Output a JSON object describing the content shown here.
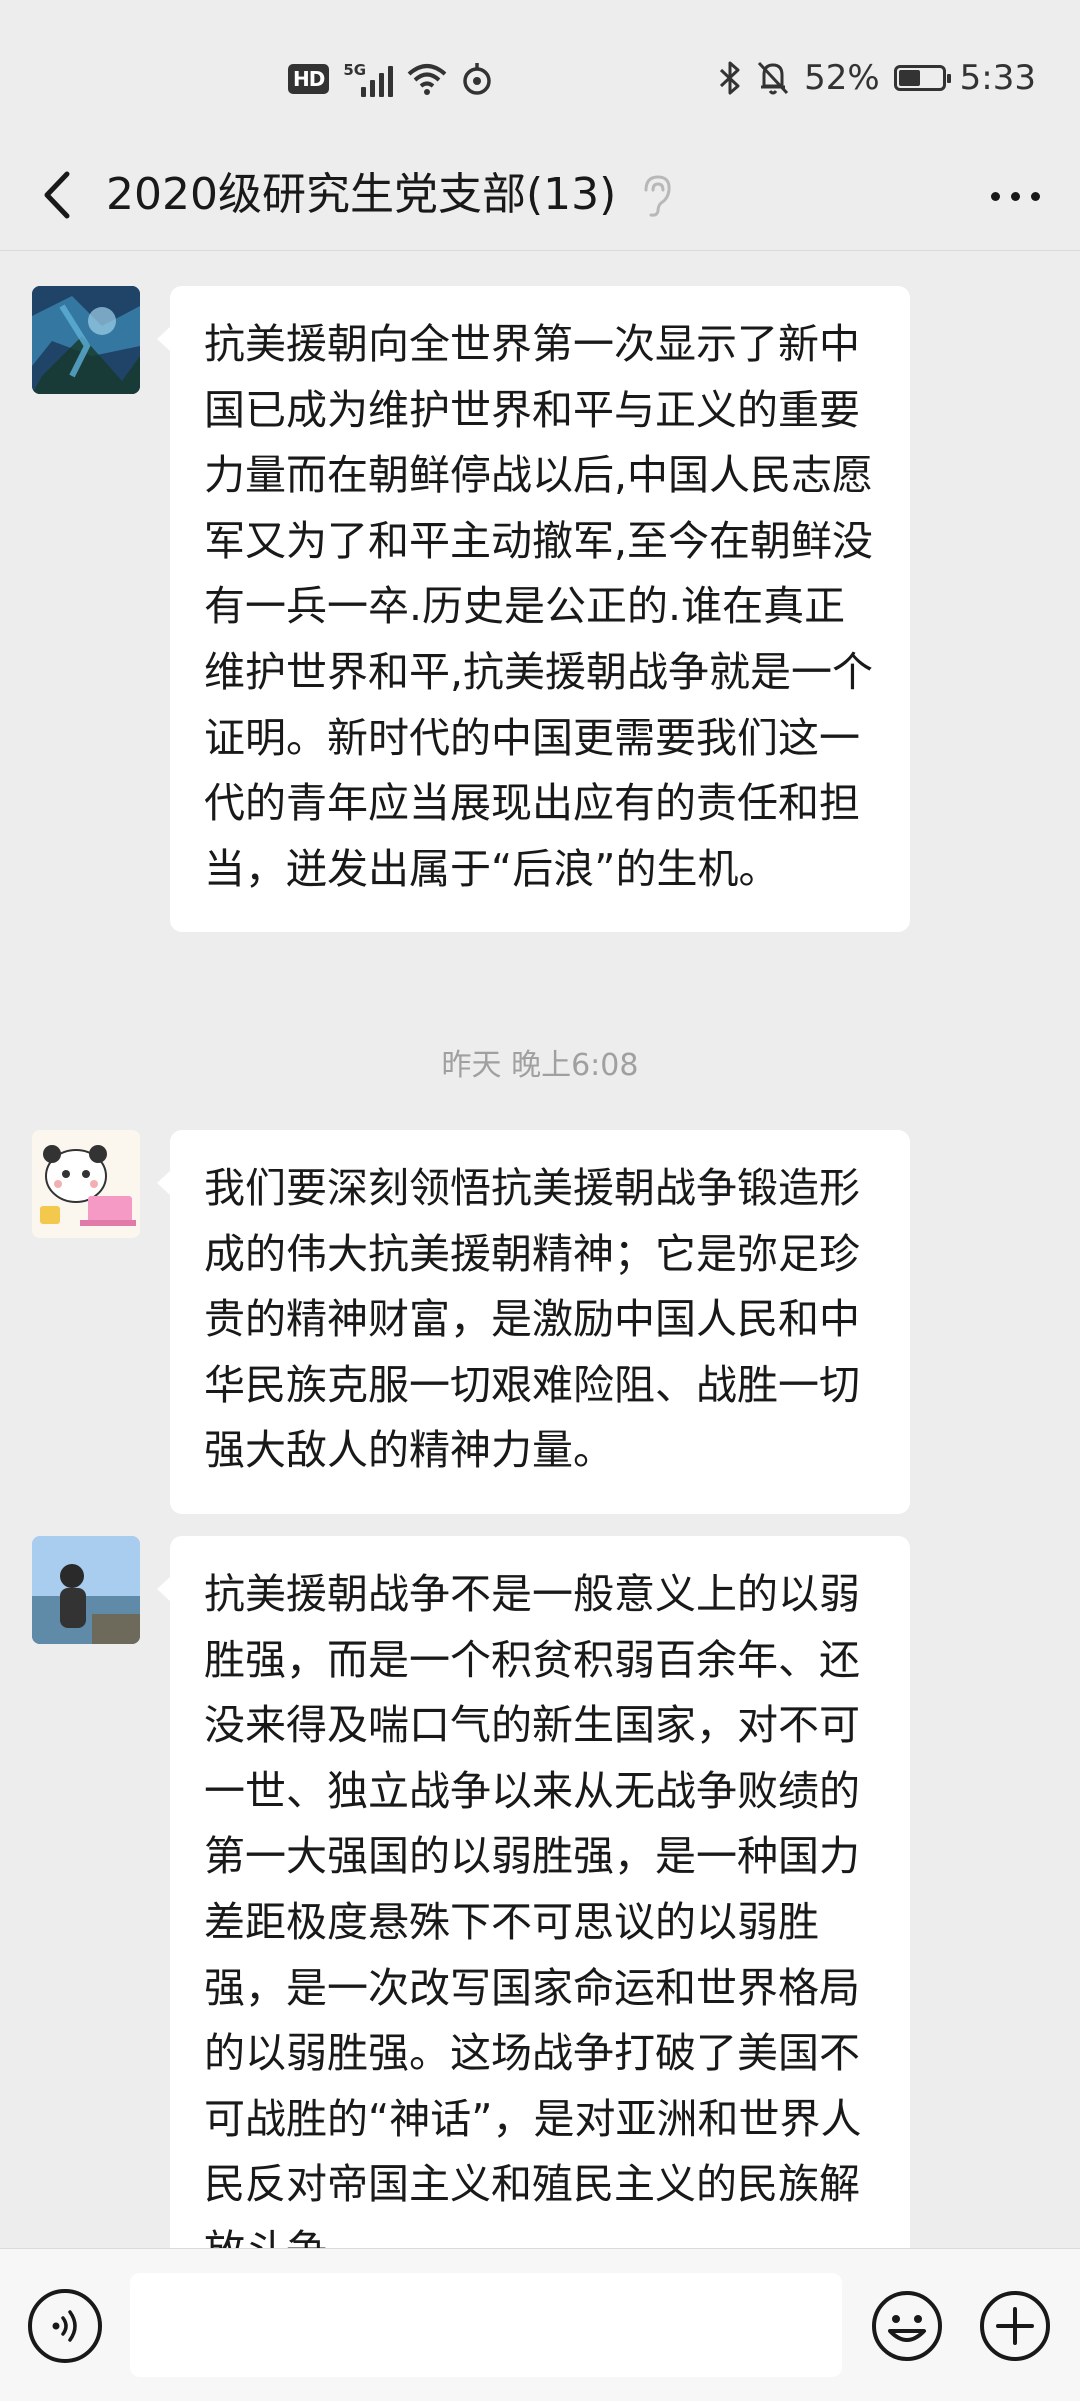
{
  "status_bar": {
    "hd": "HD",
    "network": "5G",
    "battery_percent": "52%",
    "battery_level": 0.52,
    "time": "5:33",
    "icons": [
      "hd-icon",
      "signal-icon",
      "wifi-icon",
      "hotspot-icon",
      "bluetooth-icon",
      "mute-bell-icon",
      "battery-icon"
    ]
  },
  "header": {
    "title": "2020级研究生党支部(13)",
    "back_icon": "chevron-left-icon",
    "mute_icon": "ear-icon",
    "more_icon": "more-dots-icon"
  },
  "messages": [
    {
      "avatar": "avatar-blue-abstract",
      "text": "抗美援朝向全世界第一次显示了新中国已成为维护世界和平与正义的重要力量而在朝鲜停战以后,中国人民志愿军又为了和平主动撤军,至今在朝鲜没有一兵一卒.历史是公正的.谁在真正维护世界和平,抗美援朝战争就是一个证明。新时代的中国更需要我们这一代的青年应当展现出应有的责任和担当，迸发出属于“后浪”的生机。"
    },
    {
      "timestamp": "昨天 晚上6:08"
    },
    {
      "avatar": "avatar-panda-cartoon",
      "text": "我们要深刻领悟抗美援朝战争锻造形成的伟大抗美援朝精神；它是弥足珍贵的精神财富，是激励中国人民和中华民族克服一切艰难险阻、战胜一切强大敌人的精神力量。"
    },
    {
      "avatar": "avatar-person-seaside",
      "text": "抗美援朝战争不是一般意义上的以弱胜强，而是一个积贫积弱百余年、还没来得及喘口气的新生国家，对不可一世、独立战争以来从无战争败绩的第一大强国的以弱胜强，是一种国力差距极度悬殊下不可思议的以弱胜强，是一次改写国家命运和世界格局的以弱胜强。这场战争打破了美国不可战胜的“神话”，是对亚洲和世界人民反对帝国主义和殖民主义的民族解放斗争"
    }
  ],
  "input_bar": {
    "voice_icon": "voice-icon",
    "input_value": "",
    "emoji_icon": "emoji-icon",
    "plus_icon": "plus-icon"
  }
}
